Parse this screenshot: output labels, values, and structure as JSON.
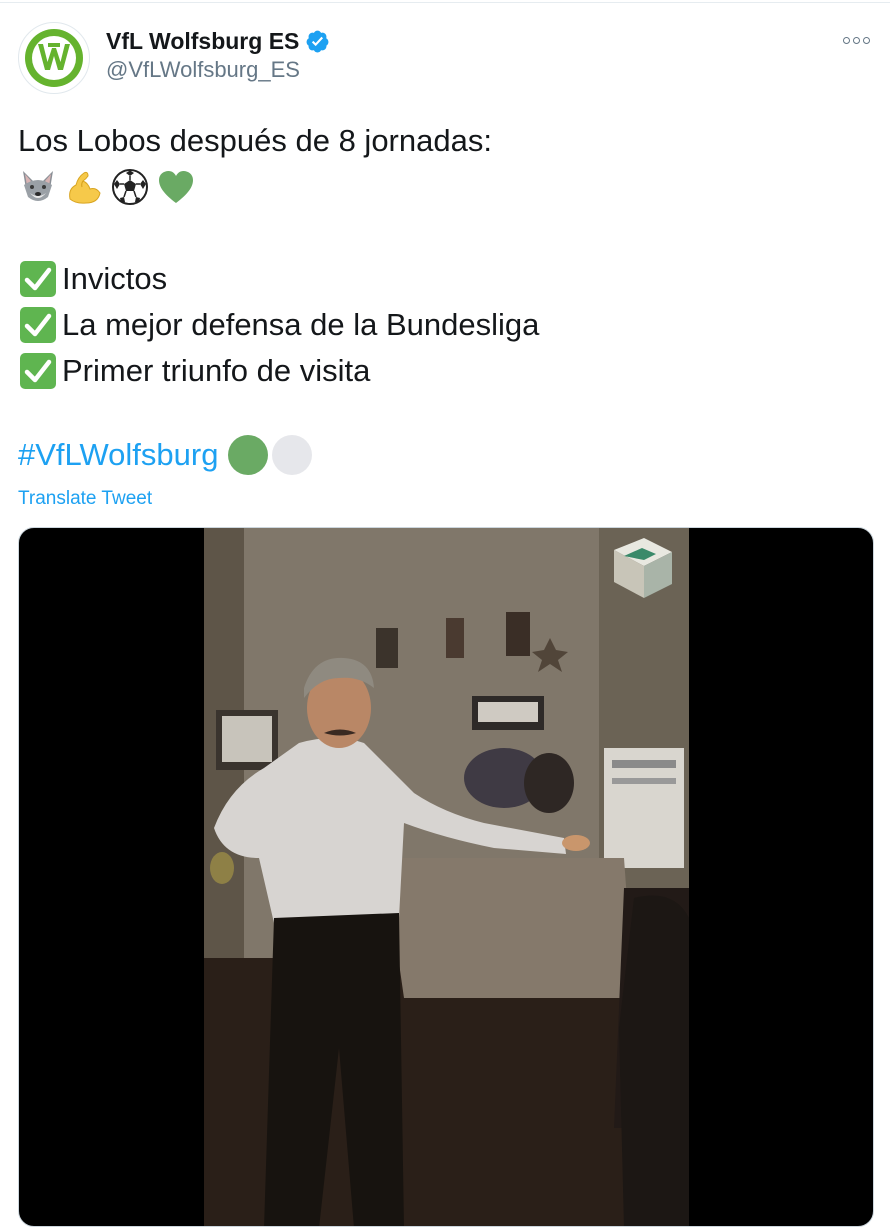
{
  "tweet": {
    "display_name": "VfL Wolfsburg ES",
    "handle": "@VfLWolfsburg_ES",
    "verified_icon": "verified-badge-icon",
    "more_icon": "more-options-icon",
    "lines": [
      "Los Lobos después de 8 jornadas:",
      "Invictos",
      "La mejor defensa de la Bundesliga",
      "Primer triunfo de visita"
    ],
    "emojis": [
      "wolf-icon",
      "flexed-biceps-icon",
      "soccer-ball-icon",
      "green-heart-icon"
    ],
    "hashtag": "#VfLWolfsburg",
    "translate_label": "Translate Tweet",
    "colors": {
      "link": "#1da1f2",
      "text": "#14171a",
      "secondary": "#657786",
      "brand_green": "#65b32e",
      "check_green": "#5fb550"
    }
  }
}
